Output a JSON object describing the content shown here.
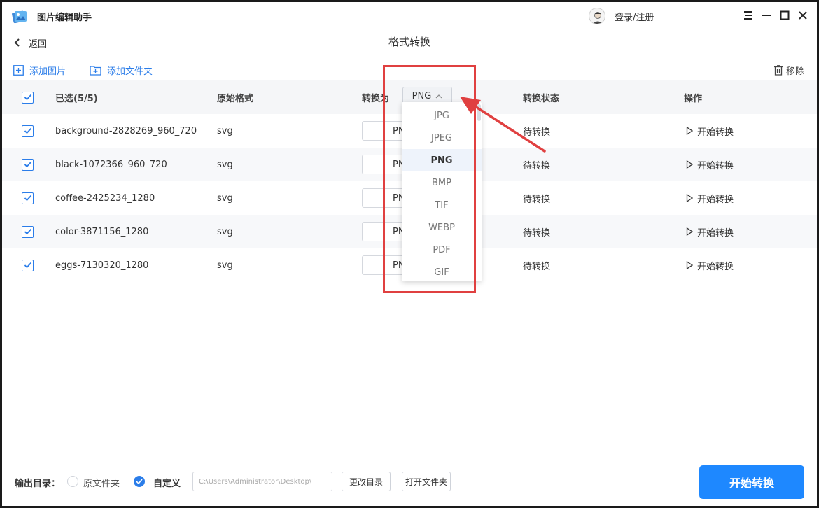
{
  "app": {
    "title": "图片编辑助手",
    "login": "登录/注册"
  },
  "header": {
    "back_label": "返回",
    "page_title": "格式转换"
  },
  "toolbar": {
    "add_image": "添加图片",
    "add_folder": "添加文件夹",
    "remove": "移除"
  },
  "table": {
    "selected_label": "已选(5/5)",
    "col_original_format": "原始格式",
    "col_convert_to": "转换为",
    "col_status": "转换状态",
    "col_action": "操作",
    "global_format": "PNG",
    "rows": [
      {
        "name": "background-2828269_960_720",
        "format": "svg",
        "target": "PNG",
        "status": "待转换",
        "action": "开始转换"
      },
      {
        "name": "black-1072366_960_720",
        "format": "svg",
        "target": "PNG",
        "status": "待转换",
        "action": "开始转换"
      },
      {
        "name": "coffee-2425234_1280",
        "format": "svg",
        "target": "PNG",
        "status": "待转换",
        "action": "开始转换"
      },
      {
        "name": "color-3871156_1280",
        "format": "svg",
        "target": "PNG",
        "status": "待转换",
        "action": "开始转换"
      },
      {
        "name": "eggs-7130320_1280",
        "format": "svg",
        "target": "PNG",
        "status": "待转换",
        "action": "开始转换"
      }
    ]
  },
  "dropdown": {
    "options": [
      "JPG",
      "JPEG",
      "PNG",
      "BMP",
      "TIF",
      "WEBP",
      "PDF",
      "GIF"
    ],
    "selected": "PNG"
  },
  "footer": {
    "output_label": "输出目录：",
    "option_original": "原文件夹",
    "option_custom": "自定义",
    "path": "C:\\Users\\Administrator\\Desktop\\",
    "change_dir": "更改目录",
    "open_folder": "打开文件夹",
    "start": "开始转换"
  },
  "colors": {
    "accent": "#1e88ff",
    "highlight": "#e04040",
    "link": "#2b7de9"
  }
}
